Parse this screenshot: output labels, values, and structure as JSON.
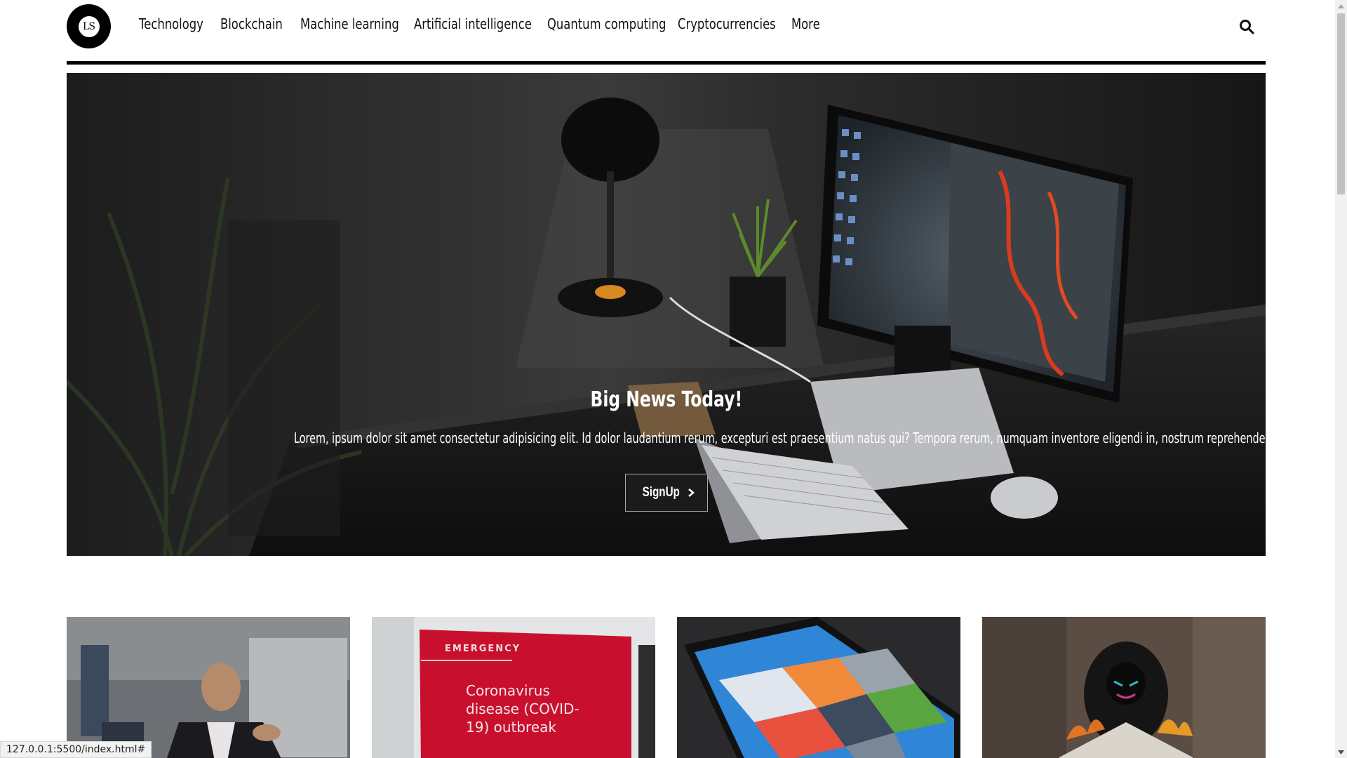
{
  "logo": {
    "text": "LS"
  },
  "nav": {
    "items": [
      "Technology",
      "Blockchain",
      "Machine learning",
      "Artificial intelligence",
      "Quantum computing",
      "Cryptocurrencies",
      "More"
    ]
  },
  "icons": {
    "search": "search-icon",
    "signup_arrow": "chevron-right-icon"
  },
  "hero": {
    "title": "Big News Today!",
    "text": "Lorem, ipsum dolor sit amet consectetur adipisicing elit. Id dolor laudantium rerum, excepturi est praesentium natus qui? Tempora rerum, numquam inventore eligendi in, nostrum reprehenderit, eum cumque fugit eaque similique!",
    "button_label": "SignUp"
  },
  "cards": [
    {
      "image": "man-speaking-in-office"
    },
    {
      "image": "emergency-coronavirus-sign",
      "sign_header": "EMERGENCY",
      "sign_lines": [
        "Coronavirus",
        "disease (COVID-",
        "19) outbreak"
      ]
    },
    {
      "image": "tablet-with-app-collections"
    },
    {
      "image": "hooded-figure-burning-newspaper"
    }
  ],
  "status": {
    "url": "127.0.0.1:5500/index.html#"
  },
  "colors": {
    "accent": "#000000",
    "hero_bg": "#141414",
    "sign_red": "#c8102e"
  }
}
